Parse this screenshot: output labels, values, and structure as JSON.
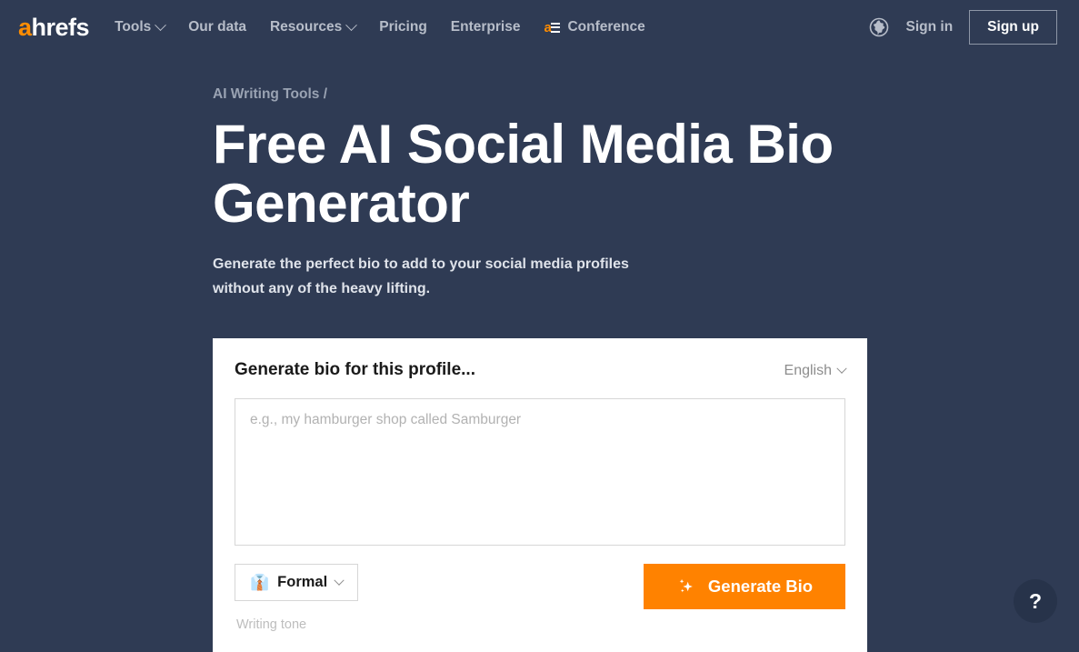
{
  "brand": {
    "name_accent": "a",
    "name_rest": "hrefs"
  },
  "nav": {
    "items": [
      {
        "label": "Tools",
        "has_caret": true
      },
      {
        "label": "Our data",
        "has_caret": false
      },
      {
        "label": "Resources",
        "has_caret": true
      },
      {
        "label": "Pricing",
        "has_caret": false
      },
      {
        "label": "Enterprise",
        "has_caret": false
      },
      {
        "label": "Conference",
        "has_caret": false,
        "icon": "ahrefs-conference-icon"
      }
    ],
    "conference_icon_letter": "a",
    "globe_icon": "globe-icon",
    "sign_in": "Sign in",
    "sign_up": "Sign up"
  },
  "hero": {
    "breadcrumb": "AI Writing Tools /",
    "title": "Free AI Social Media Bio Generator",
    "subtitle": "Generate the perfect bio to add to your social media profiles without any of the heavy lifting."
  },
  "card": {
    "title": "Generate bio for this profile...",
    "language": "English",
    "input_value": "",
    "input_placeholder": "e.g., my hamburger shop called Samburger",
    "tone_emoji": "👔",
    "tone_value": "Formal",
    "tone_label": "Writing tone",
    "submit_label": "Generate Bio",
    "submit_icon": "sparkles-icon"
  },
  "help": {
    "label": "?",
    "icon": "question-mark-icon"
  },
  "colors": {
    "page_background": "#2f3b54",
    "accent_orange": "#ff8200",
    "card_background": "#ffffff",
    "nav_link": "#b7bdc9"
  }
}
